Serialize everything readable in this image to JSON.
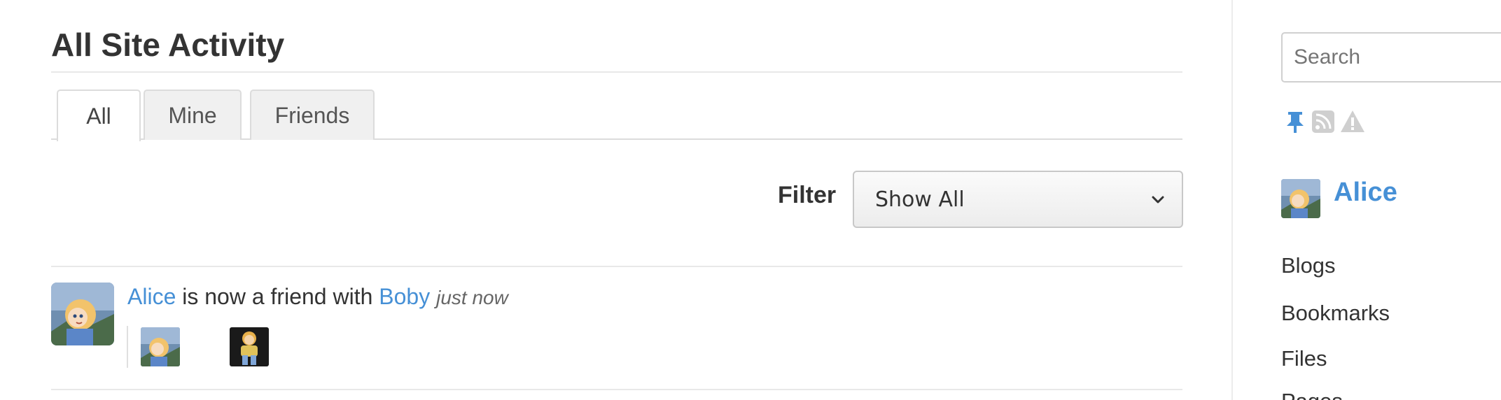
{
  "page": {
    "title": "All Site Activity"
  },
  "tabs": [
    {
      "label": "All",
      "active": true
    },
    {
      "label": "Mine",
      "active": false
    },
    {
      "label": "Friends",
      "active": false
    }
  ],
  "filter": {
    "label": "Filter",
    "selected": "Show All"
  },
  "activity": {
    "actor": "Alice",
    "verb": "is now a friend with",
    "target": "Boby",
    "time": "just now"
  },
  "sidebar": {
    "search_placeholder": "Search",
    "icons": [
      "pin-icon",
      "rss-icon",
      "warning-icon"
    ],
    "owner_name": "Alice",
    "links": [
      "Blogs",
      "Bookmarks",
      "Files",
      "Pages"
    ]
  },
  "colors": {
    "link": "#4690d6",
    "accent": "#4690d6",
    "text": "#333333"
  }
}
